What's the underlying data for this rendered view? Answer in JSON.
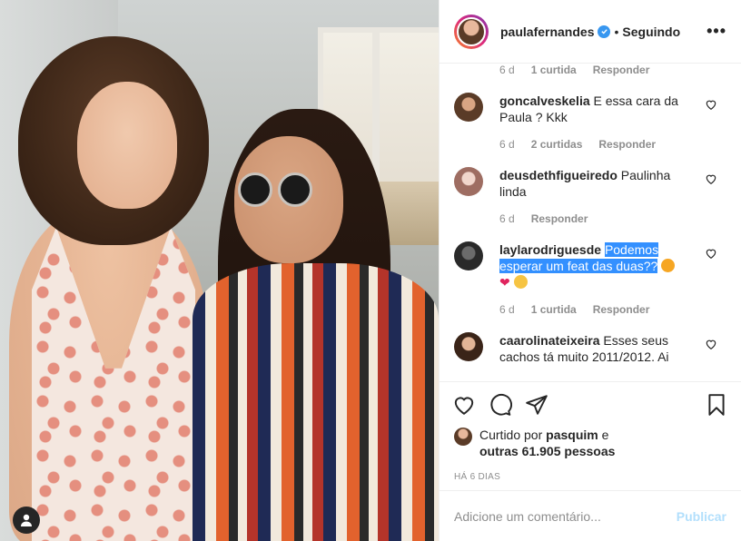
{
  "header": {
    "username": "paulafernandes",
    "separator": "•",
    "follow_status": "Seguindo",
    "more": "•••"
  },
  "top_meta": {
    "time": "6 d",
    "likes": "1 curtida",
    "reply": "Responder"
  },
  "comments": [
    {
      "username": "goncalveskelia",
      "text": "E essa cara da Paula ? Kkk",
      "time": "6 d",
      "likes": "2 curtidas",
      "reply": "Responder"
    },
    {
      "username": "deusdethfigueiredo",
      "text": "Paulinha linda",
      "time": "6 d",
      "reply": "Responder"
    },
    {
      "username": "laylarodriguesde",
      "text": "Podemos esperar um feat das duas??",
      "time": "6 d",
      "likes": "1 curtida",
      "reply": "Responder"
    },
    {
      "username": "caarolinateixeira",
      "text": "Esses seus cachos tá muito 2011/2012. Ai"
    }
  ],
  "likes": {
    "prefix": "Curtido por",
    "first_user": "pasquim",
    "conjunction": "e",
    "others": "outras 61.905 pessoas"
  },
  "timestamp": "HÁ 6 DIAS",
  "comment_box": {
    "placeholder": "Adicione um comentário...",
    "post_label": "Publicar"
  },
  "colors": {
    "verified": "#3897f0",
    "highlight": "#3390ff",
    "publish_disabled": "#b2dffc",
    "muted": "#8e8e8e"
  },
  "icons": [
    "heart-icon",
    "comment-icon",
    "share-icon",
    "bookmark-icon",
    "verified-icon",
    "user-tag-icon"
  ]
}
